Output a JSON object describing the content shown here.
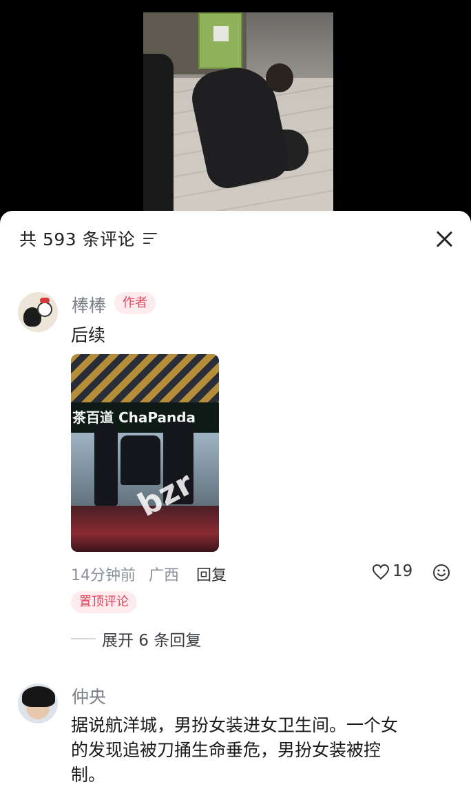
{
  "comments_panel": {
    "title": "共 593 条评论",
    "sort_icon": "sort-lines-icon",
    "close_icon": "close-icon"
  },
  "comments": [
    {
      "username": "棒棒",
      "badge": "作者",
      "text": "后续",
      "image_sign_text": "茶百道 ChaPanda",
      "image_watermark": "bzr",
      "time": "14分钟前",
      "location": "广西",
      "reply_label": "回复",
      "likes": "19",
      "pinned_label": "置顶评论",
      "expand_replies_label": "展开 6 条回复"
    },
    {
      "username": "仲央",
      "text_lines": [
        "据说航洋城，男扮女装进女卫生间。一个女",
        "的发现追被刀捅生命垂危，男扮女装被控",
        "制。"
      ]
    }
  ],
  "colors": {
    "badge_bg": "#fdebee",
    "badge_text": "#e0445d",
    "username": "#7b8089",
    "meta": "#8a8f98"
  }
}
